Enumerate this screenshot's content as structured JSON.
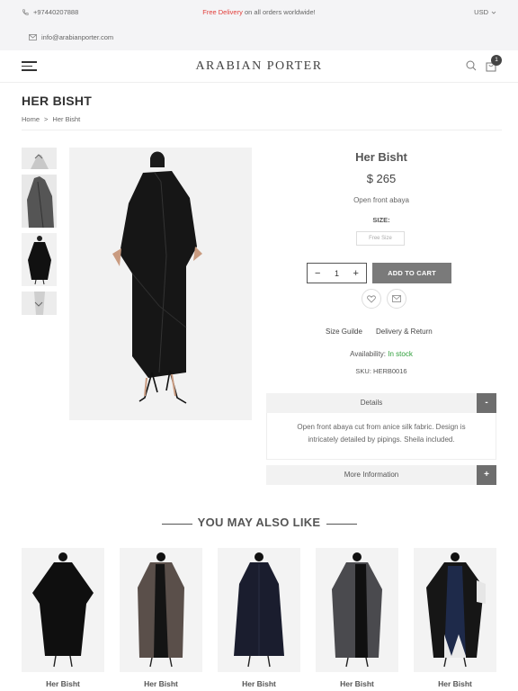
{
  "topbar": {
    "phone": "+97440207888",
    "email": "info@arabianporter.com",
    "promo_highlight": "Free Delivery",
    "promo_rest": "on all orders worldwide!",
    "currency": "USD"
  },
  "header": {
    "logo": "ARABIAN PORTER",
    "cart_count": "1"
  },
  "page": {
    "title": "HER BISHT",
    "breadcrumb": {
      "home": "Home",
      "separator": ">",
      "current": "Her Bisht"
    }
  },
  "product": {
    "name": "Her Bisht",
    "price": "$ 265",
    "short_description": "Open front abaya",
    "size_label": "SIZE:",
    "size_option": "Free Size",
    "quantity": "1",
    "add_to_cart": "ADD TO CART",
    "size_guide": "Size Guilde",
    "delivery_return": "Delivery & Return",
    "availability_label": "Availability:",
    "availability_value": "In stock",
    "sku_label": "SKU:",
    "sku_value": "HERB0016"
  },
  "accordion": {
    "details_title": "Details",
    "details_toggle": "-",
    "details_body": "Open front abaya cut from anice silk fabric. Design is intricately detailed by pipings. Sheila included.",
    "more_title": "More Information",
    "more_toggle": "+"
  },
  "related": {
    "heading": "YOU MAY ALSO LIKE",
    "items": [
      {
        "name": "Her Bisht"
      },
      {
        "name": "Her Bisht"
      },
      {
        "name": "Her Bisht"
      },
      {
        "name": "Her Bisht"
      },
      {
        "name": "Her Bisht"
      }
    ]
  },
  "colors": {
    "promo_red": "#e2403c",
    "in_stock_green": "#2e9e3a",
    "add_to_cart_bg": "#7a7a7a",
    "accordion_toggle_bg": "#6e6e6e"
  },
  "icons": [
    "phone-icon",
    "mail-icon",
    "chevron-down-icon",
    "menu-icon",
    "search-icon",
    "cart-icon",
    "heart-icon",
    "envelope-icon",
    "chevron-up-icon",
    "minus-icon",
    "plus-icon"
  ]
}
